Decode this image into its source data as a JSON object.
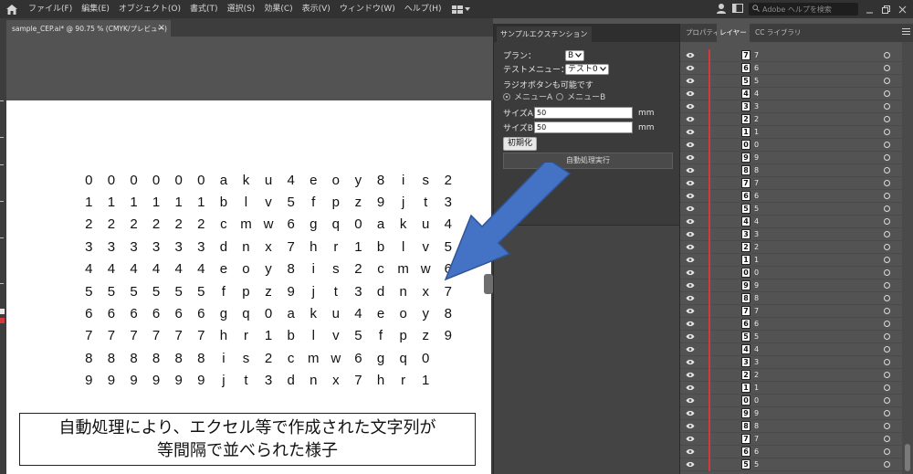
{
  "menubar": {
    "items": [
      "ファイル(F)",
      "編集(E)",
      "オブジェクト(O)",
      "書式(T)",
      "選択(S)",
      "効果(C)",
      "表示(V)",
      "ウィンドウ(W)",
      "ヘルプ(H)"
    ],
    "help_placeholder": "Adobe ヘルプを検索"
  },
  "document": {
    "tab_title": "sample_CEP.ai* @ 90.75 % (CMYK/プレビュー)",
    "close": "×"
  },
  "artboard": {
    "grid": [
      [
        "0",
        "0",
        "0",
        "0",
        "0",
        "0",
        "a",
        "k",
        "u",
        "4",
        "e",
        "o",
        "y",
        "8",
        "i",
        "s",
        "2"
      ],
      [
        "1",
        "1",
        "1",
        "1",
        "1",
        "1",
        "b",
        "l",
        "v",
        "5",
        "f",
        "p",
        "z",
        "9",
        "j",
        "t",
        "3"
      ],
      [
        "2",
        "2",
        "2",
        "2",
        "2",
        "2",
        "c",
        "m",
        "w",
        "6",
        "g",
        "q",
        "0",
        "a",
        "k",
        "u",
        "4"
      ],
      [
        "3",
        "3",
        "3",
        "3",
        "3",
        "3",
        "d",
        "n",
        "x",
        "7",
        "h",
        "r",
        "1",
        "b",
        "l",
        "v",
        "5"
      ],
      [
        "4",
        "4",
        "4",
        "4",
        "4",
        "4",
        "e",
        "o",
        "y",
        "8",
        "i",
        "s",
        "2",
        "c",
        "m",
        "w",
        "6"
      ],
      [
        "5",
        "5",
        "5",
        "5",
        "5",
        "5",
        "f",
        "p",
        "z",
        "9",
        "j",
        "t",
        "3",
        "d",
        "n",
        "x",
        "7"
      ],
      [
        "6",
        "6",
        "6",
        "6",
        "6",
        "6",
        "g",
        "q",
        "0",
        "a",
        "k",
        "u",
        "4",
        "e",
        "o",
        "y",
        "8"
      ],
      [
        "7",
        "7",
        "7",
        "7",
        "7",
        "7",
        "h",
        "r",
        "1",
        "b",
        "l",
        "v",
        "5",
        "f",
        "p",
        "z",
        "9"
      ],
      [
        "8",
        "8",
        "8",
        "8",
        "8",
        "8",
        "i",
        "s",
        "2",
        "c",
        "m",
        "w",
        "6",
        "g",
        "q",
        "0",
        ""
      ],
      [
        "9",
        "9",
        "9",
        "9",
        "9",
        "9",
        "j",
        "t",
        "3",
        "d",
        "n",
        "x",
        "7",
        "h",
        "r",
        "1",
        ""
      ]
    ],
    "caption_line1": "自動処理により、エクセル等で作成された文字列が",
    "caption_line2": "等間隔で並べられた様子"
  },
  "extension": {
    "tab_label": "サンプルエクステンション",
    "plan_label": "プラン：",
    "plan_value": "B",
    "test_menu_label": "テストメニュー：",
    "test_menu_value": "テスト0",
    "radio_note": "ラジオボタンも可能です",
    "radio_a": "メニューA",
    "radio_b": "メニューB",
    "size_a_label": "サイズA",
    "size_a_value": "50",
    "size_b_label": "サイズB",
    "size_b_value": "50",
    "unit": "mm",
    "init_button": "初期化",
    "run_button": "自動処理実行"
  },
  "layers_panel": {
    "tabs": [
      "プロパティ",
      "レイヤー",
      "CC ライブラリ"
    ],
    "active_tab": "レイヤー",
    "accent_color": "#d43a3a",
    "layers": [
      {
        "thumb": "7",
        "name": "7"
      },
      {
        "thumb": "6",
        "name": "6"
      },
      {
        "thumb": "5",
        "name": "5"
      },
      {
        "thumb": "4",
        "name": "4"
      },
      {
        "thumb": "3",
        "name": "3"
      },
      {
        "thumb": "2",
        "name": "2"
      },
      {
        "thumb": "1",
        "name": "1"
      },
      {
        "thumb": "0",
        "name": "0"
      },
      {
        "thumb": "9",
        "name": "9"
      },
      {
        "thumb": "8",
        "name": "8"
      },
      {
        "thumb": "7",
        "name": "7"
      },
      {
        "thumb": "6",
        "name": "6"
      },
      {
        "thumb": "5",
        "name": "5"
      },
      {
        "thumb": "4",
        "name": "4"
      },
      {
        "thumb": "3",
        "name": "3"
      },
      {
        "thumb": "2",
        "name": "2"
      },
      {
        "thumb": "1",
        "name": "1"
      },
      {
        "thumb": "0",
        "name": "0"
      },
      {
        "thumb": "9",
        "name": "9"
      },
      {
        "thumb": "8",
        "name": "8"
      },
      {
        "thumb": "7",
        "name": "7"
      },
      {
        "thumb": "6",
        "name": "6"
      },
      {
        "thumb": "5",
        "name": "5"
      },
      {
        "thumb": "4",
        "name": "4"
      },
      {
        "thumb": "3",
        "name": "3"
      },
      {
        "thumb": "2",
        "name": "2"
      },
      {
        "thumb": "1",
        "name": "1"
      },
      {
        "thumb": "0",
        "name": "0"
      },
      {
        "thumb": "9",
        "name": "9"
      },
      {
        "thumb": "8",
        "name": "8"
      },
      {
        "thumb": "7",
        "name": "7"
      },
      {
        "thumb": "6",
        "name": "6"
      },
      {
        "thumb": "5",
        "name": "5"
      }
    ]
  }
}
